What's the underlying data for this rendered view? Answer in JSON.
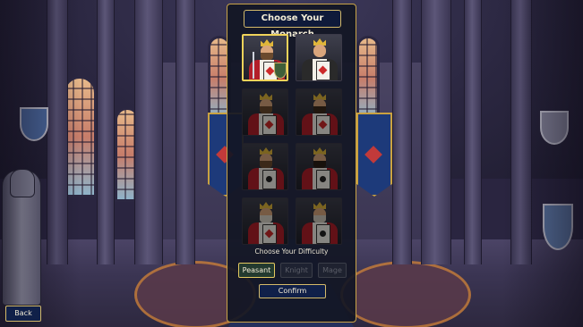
{
  "title": "Choose Your Monarch",
  "monarchs": [
    {
      "icon": "king-of-spades-portrait-icon",
      "suit": "spade",
      "selected": true
    },
    {
      "icon": "queen-of-hearts-portrait-icon",
      "suit": "heart",
      "selected": false
    },
    {
      "icon": "king-of-diamonds-portrait-icon",
      "suit": "diamond",
      "selected": false
    },
    {
      "icon": "king-of-diamonds-portrait-icon",
      "suit": "diamond",
      "selected": false
    },
    {
      "icon": "king-of-clubs-portrait-icon",
      "suit": "club",
      "selected": false
    },
    {
      "icon": "king-of-clubs-portrait-icon",
      "suit": "club",
      "selected": false
    },
    {
      "icon": "king-of-hearts-portrait-icon",
      "suit": "heart",
      "selected": false
    },
    {
      "icon": "king-of-spades-portrait-icon",
      "suit": "spade",
      "selected": false
    }
  ],
  "difficulty": {
    "label": "Choose Your Difficulty",
    "options": [
      {
        "label": "Peasant",
        "active": true
      },
      {
        "label": "Knight",
        "active": false
      },
      {
        "label": "Mage",
        "active": false
      }
    ]
  },
  "confirm_label": "Confirm",
  "back_label": "Back",
  "colors": {
    "accent_gold": "#d4ba6a",
    "selected_border": "#f0d35a",
    "button_bg": "#102049",
    "active_difficulty_bg": "#233a2f"
  }
}
